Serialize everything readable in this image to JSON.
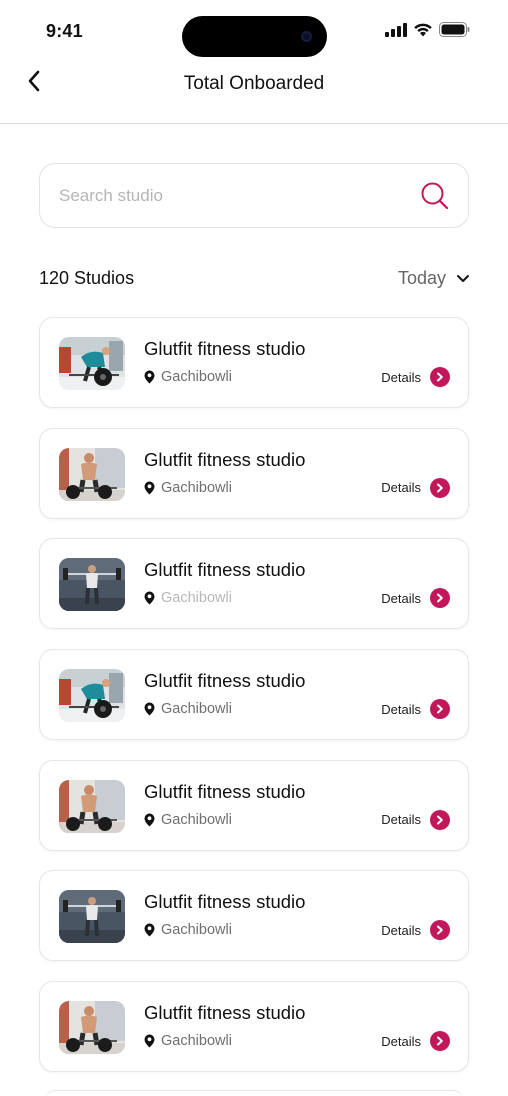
{
  "status_bar": {
    "time": "9:41"
  },
  "header": {
    "title": "Total Onboarded"
  },
  "search": {
    "placeholder": "Search studio",
    "value": ""
  },
  "summary": {
    "count_label": "120 Studios",
    "filter_label": "Today"
  },
  "colors": {
    "accent": "#c2185b",
    "border": "#e6e6e6",
    "muted_text": "#6f6f6f"
  },
  "studios": [
    {
      "name": "Glutfit fitness studio",
      "location": "Gachibowli",
      "action": "Details",
      "photo": "deadlift-side"
    },
    {
      "name": "Glutfit fitness studio",
      "location": "Gachibowli",
      "action": "Details",
      "photo": "deadlift-front"
    },
    {
      "name": "Glutfit fitness studio",
      "location": "Gachibowli",
      "action": "Details",
      "photo": "barbell-standing"
    },
    {
      "name": "Glutfit fitness studio",
      "location": "Gachibowli",
      "action": "Details",
      "photo": "deadlift-side"
    },
    {
      "name": "Glutfit fitness studio",
      "location": "Gachibowli",
      "action": "Details",
      "photo": "deadlift-front"
    },
    {
      "name": "Glutfit fitness studio",
      "location": "Gachibowli",
      "action": "Details",
      "photo": "barbell-standing"
    },
    {
      "name": "Glutfit fitness studio",
      "location": "Gachibowli",
      "action": "Details",
      "photo": "deadlift-front"
    }
  ]
}
